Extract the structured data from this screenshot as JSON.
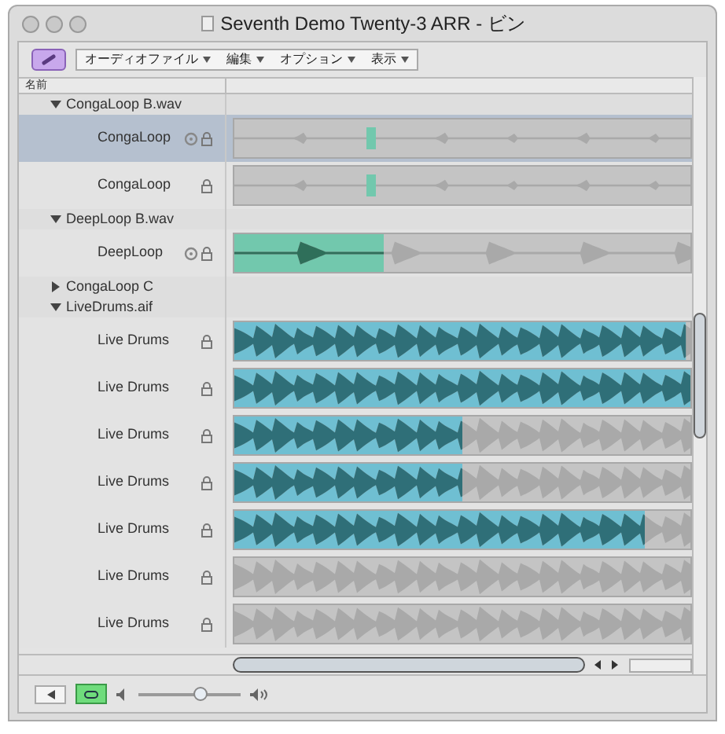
{
  "window": {
    "title": "Seventh Demo Twenty-3 ARR - ビン"
  },
  "toolbar": {
    "link_button": {
      "selected": true
    },
    "menus": [
      "オーディオファイル",
      "編集",
      "オプション",
      "表示"
    ]
  },
  "header": {
    "name_column": "名前"
  },
  "groups": [
    {
      "name": "CongaLoop B.wav",
      "expanded": true,
      "children": [
        {
          "name": "CongaLoop",
          "selected": true,
          "tempo_icon": true,
          "kind": "conga"
        },
        {
          "name": "CongaLoop",
          "selected": false,
          "tempo_icon": false,
          "kind": "conga"
        }
      ]
    },
    {
      "name": "DeepLoop B.wav",
      "expanded": true,
      "children": [
        {
          "name": "DeepLoop",
          "selected": false,
          "tempo_icon": true,
          "kind": "deep"
        }
      ]
    },
    {
      "name": "CongaLoop C",
      "expanded": false
    },
    {
      "name": "LiveDrums.aif",
      "expanded": true,
      "children": [
        {
          "name": "Live Drums",
          "selected": false,
          "tempo_icon": false,
          "kind": "drums",
          "level": 0.99
        },
        {
          "name": "Live Drums",
          "selected": false,
          "tempo_icon": false,
          "kind": "drums",
          "level": 1.0
        },
        {
          "name": "Live Drums",
          "selected": false,
          "tempo_icon": false,
          "kind": "drums",
          "level": 0.5
        },
        {
          "name": "Live Drums",
          "selected": false,
          "tempo_icon": false,
          "kind": "drums",
          "level": 0.5
        },
        {
          "name": "Live Drums",
          "selected": false,
          "tempo_icon": false,
          "kind": "drums",
          "level": 0.9
        },
        {
          "name": "Live Drums",
          "selected": false,
          "tempo_icon": false,
          "kind": "drums"
        },
        {
          "name": "Live Drums",
          "selected": false,
          "tempo_icon": false,
          "kind": "drums"
        }
      ]
    }
  ],
  "bottom_bar": {
    "loop_button": {
      "on": true
    },
    "volume": {
      "level": 0.6
    }
  }
}
